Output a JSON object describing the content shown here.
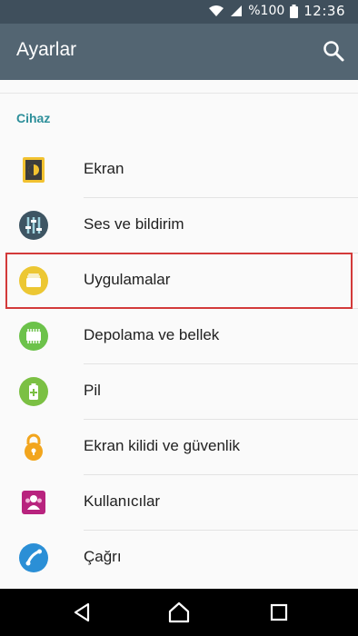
{
  "status": {
    "battery": "%100",
    "time": "12:36"
  },
  "appbar": {
    "title": "Ayarlar"
  },
  "section": "Cihaz",
  "items": [
    {
      "label": "Ekran",
      "icon": "display-icon",
      "color": "#e8b92a"
    },
    {
      "label": "Ses ve bildirim",
      "icon": "sound-icon",
      "color": "#3e5563"
    },
    {
      "label": "Uygulamalar",
      "icon": "apps-icon",
      "color": "#e8c32e",
      "highlighted": true
    },
    {
      "label": "Depolama ve bellek",
      "icon": "storage-icon",
      "color": "#6cc24a"
    },
    {
      "label": "Pil",
      "icon": "battery-icon",
      "color": "#7bc043"
    },
    {
      "label": "Ekran kilidi ve güvenlik",
      "icon": "lock-icon",
      "color": "#f2a51d"
    },
    {
      "label": "Kullanıcılar",
      "icon": "users-icon",
      "color": "#b8237e"
    },
    {
      "label": "Çağrı",
      "icon": "phone-icon",
      "color": "#2b8fd6"
    }
  ]
}
